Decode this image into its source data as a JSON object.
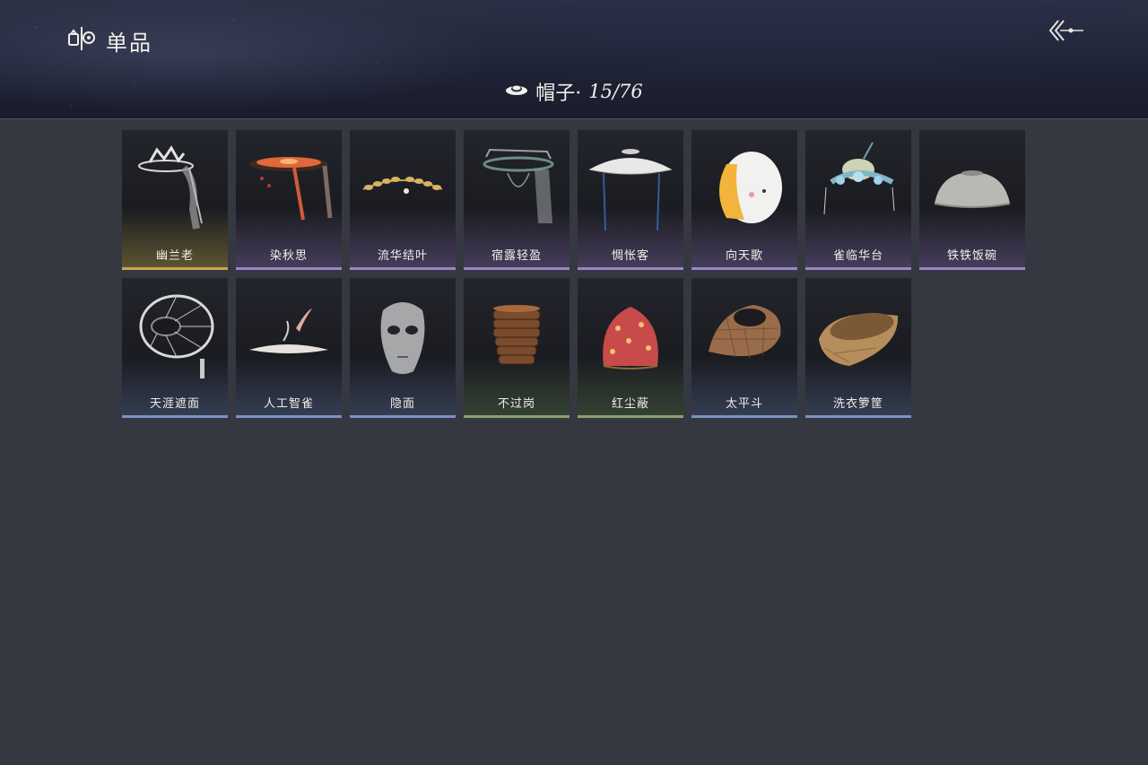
{
  "header": {
    "title": "单品",
    "title_icon": "wardrobe-icon",
    "back_icon": "back-arrows-icon"
  },
  "category": {
    "icon": "hat-icon",
    "label": "帽子·",
    "count": "15/76"
  },
  "items": [
    {
      "name": "幽兰老",
      "rarity": "gold",
      "icon": "veiled-crown-icon"
    },
    {
      "name": "染秋思",
      "rarity": "purple",
      "icon": "red-parasol-hat-icon"
    },
    {
      "name": "流华结叶",
      "rarity": "purple",
      "icon": "laurel-wreath-icon"
    },
    {
      "name": "宿露轻盈",
      "rarity": "purple",
      "icon": "veil-hat-icon"
    },
    {
      "name": "惆怅客",
      "rarity": "purple",
      "icon": "white-douli-hat-icon"
    },
    {
      "name": "向天歌",
      "rarity": "purple",
      "icon": "goose-hood-icon"
    },
    {
      "name": "雀临华台",
      "rarity": "purple",
      "icon": "floral-headdress-icon"
    },
    {
      "name": "铁铁饭碗",
      "rarity": "purple",
      "icon": "iron-bowl-icon"
    },
    {
      "name": "天涯遮面",
      "rarity": "blue",
      "icon": "bamboo-frame-hat-icon"
    },
    {
      "name": "人工智雀",
      "rarity": "blue",
      "icon": "bird-hat-icon"
    },
    {
      "name": "隐面",
      "rarity": "blue",
      "icon": "silver-mask-icon"
    },
    {
      "name": "不过岗",
      "rarity": "green",
      "icon": "stacked-bowls-icon"
    },
    {
      "name": "红尘蔽",
      "rarity": "green",
      "icon": "red-hood-icon"
    },
    {
      "name": "太平斗",
      "rarity": "blue",
      "icon": "woven-basket-hat-icon"
    },
    {
      "name": "洗衣箩筐",
      "rarity": "blue",
      "icon": "laundry-basket-icon"
    }
  ],
  "colors": {
    "background": "#353841",
    "gold": "#c9a84a",
    "purple": "#9a86c2",
    "blue": "#7d92bf",
    "green": "#88a36c"
  }
}
